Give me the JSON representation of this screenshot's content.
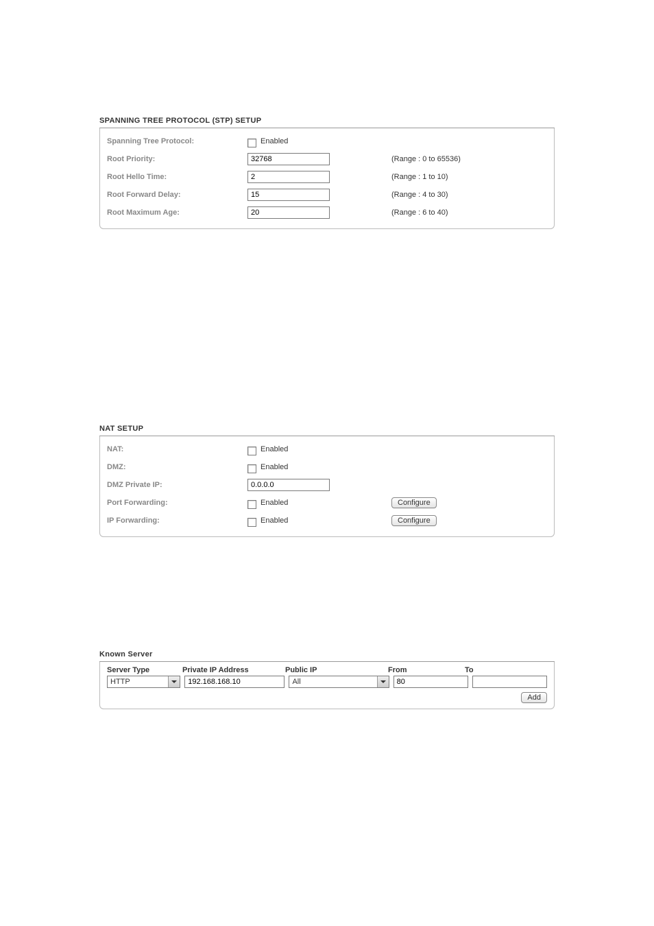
{
  "stp": {
    "title": "SPANNING TREE PROTOCOL (STP) SETUP",
    "rows": {
      "protocol": {
        "label": "Spanning Tree Protocol:",
        "enabled_label": "Enabled"
      },
      "priority": {
        "label": "Root Priority:",
        "value": "32768",
        "range": "(Range : 0 to 65536)"
      },
      "hello": {
        "label": "Root Hello Time:",
        "value": "2",
        "range": "(Range : 1 to 10)"
      },
      "fwd": {
        "label": "Root Forward Delay:",
        "value": "15",
        "range": "(Range : 4 to 30)"
      },
      "maxage": {
        "label": "Root Maximum Age:",
        "value": "20",
        "range": "(Range : 6 to 40)"
      }
    }
  },
  "nat": {
    "title": "NAT SETUP",
    "rows": {
      "nat": {
        "label": "NAT:",
        "enabled_label": "Enabled"
      },
      "dmz": {
        "label": "DMZ:",
        "enabled_label": "Enabled"
      },
      "dmzip": {
        "label": "DMZ Private IP:",
        "value": "0.0.0.0"
      },
      "pf": {
        "label": "Port Forwarding:",
        "enabled_label": "Enabled",
        "btn": "Configure"
      },
      "ipf": {
        "label": "IP Forwarding:",
        "enabled_label": "Enabled",
        "btn": "Configure"
      }
    }
  },
  "known_server": {
    "title": "Known Server",
    "headers": {
      "type": "Server Type",
      "priv": "Private IP Address",
      "pub": "Public IP",
      "from": "From",
      "to": "To"
    },
    "row": {
      "type": "HTTP",
      "priv": "192.168.168.10",
      "pub": "All",
      "from": "80",
      "to": ""
    },
    "add_btn": "Add"
  }
}
